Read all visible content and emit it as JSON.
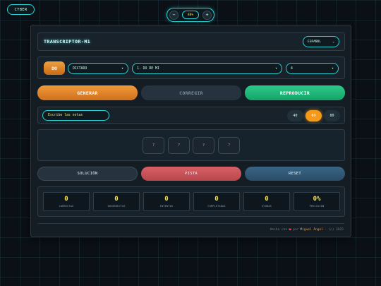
{
  "header": {
    "cyber_label": "CYBER"
  },
  "zoom": {
    "minus": "−",
    "value": "88%",
    "plus": "+"
  },
  "app": {
    "title": "TRANSCRIPTOR-M1",
    "language": {
      "selected": "ESPAÑOL",
      "chevron": "⌄"
    }
  },
  "controls": {
    "note_badge": "DO",
    "mode": {
      "selected": "DICTADO",
      "chevron": "▾"
    },
    "exercise": {
      "selected": "1. DO RE MI",
      "chevron": "▾"
    },
    "count": {
      "selected": "4",
      "chevron": "▾"
    }
  },
  "main_buttons": {
    "generate": "GENERAR",
    "correct": "CORREGIR",
    "play": "REPRODUCIR"
  },
  "notes_input": {
    "placeholder": "Escribe las notas"
  },
  "tempo_options": [
    {
      "label": "40",
      "active": false
    },
    {
      "label": "60",
      "active": true
    },
    {
      "label": "80",
      "active": false
    }
  ],
  "slots": [
    "?",
    "?",
    "?",
    "?"
  ],
  "action_buttons": {
    "solution": "SOLUCIÓN",
    "hint": "PISTA",
    "reset": "RESET"
  },
  "stats": [
    {
      "value": "0",
      "label": "CORRECTAS"
    },
    {
      "value": "0",
      "label": "INCORRECTAS"
    },
    {
      "value": "0",
      "label": "INTENTOS"
    },
    {
      "value": "0",
      "label": "COMPLETADAS"
    },
    {
      "value": "0",
      "label": "AYUDAS"
    },
    {
      "value": "0%",
      "label": "PRECISIÓN"
    }
  ],
  "footer": {
    "made_with": "Hecho con",
    "heart": "❤",
    "by": "por",
    "author": "Miguel Ángel",
    "year": "· (c) 2025"
  },
  "colors": {
    "accent": "#2ad4d4",
    "orange": "#f09a3a",
    "green": "#2ec98a",
    "red": "#d76066",
    "yellow": "#f5e050"
  }
}
